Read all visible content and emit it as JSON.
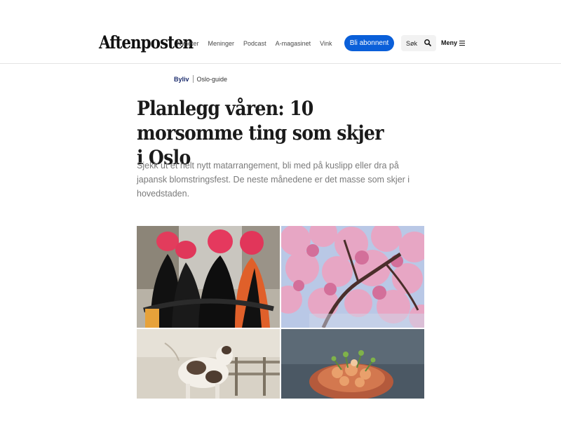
{
  "header": {
    "logo": "Aftenposten",
    "nav": [
      "Nyheter",
      "Meninger",
      "Podcast",
      "A-magasinet",
      "Vink"
    ],
    "subscribe_label": "Bli abonnent",
    "search_label": "Søk",
    "menu_label": "Meny"
  },
  "article": {
    "section": "Byliv",
    "topic": "Oslo-guide",
    "title": "Planlegg våren: 10 morsomme ting som skjer i Oslo",
    "lead": "Sjekk ut et helt nytt matarrangement, bli med på kuslipp eller dra på japansk blomstringsfest. De neste månedene er det masse som skjer i hovedstaden."
  },
  "colors": {
    "accent": "#0a5fd9",
    "section": "#1d2d6e"
  }
}
